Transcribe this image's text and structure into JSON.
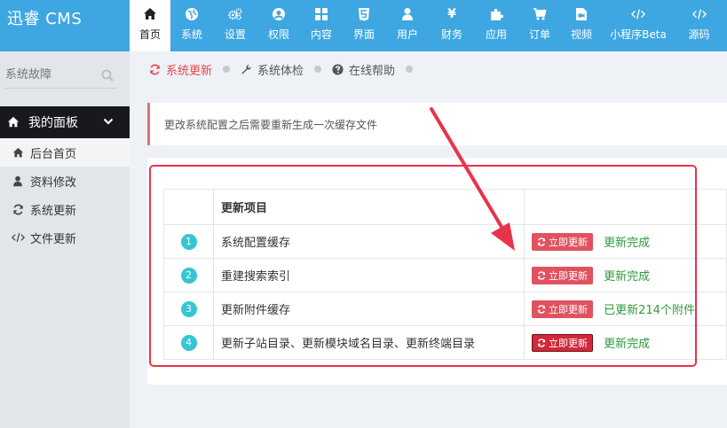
{
  "app": {
    "logo": "迅睿 CMS"
  },
  "nav": [
    {
      "label": "首页",
      "icon": "home-icon",
      "active": true
    },
    {
      "label": "系统",
      "icon": "globe-icon"
    },
    {
      "label": "设置",
      "icon": "gears-icon"
    },
    {
      "label": "权限",
      "icon": "user-circle-icon"
    },
    {
      "label": "内容",
      "icon": "grid-icon"
    },
    {
      "label": "界面",
      "icon": "html5-icon"
    },
    {
      "label": "用户",
      "icon": "user-icon"
    },
    {
      "label": "财务",
      "icon": "yen-icon"
    },
    {
      "label": "应用",
      "icon": "puzzle-icon"
    },
    {
      "label": "订单",
      "icon": "cart-icon"
    },
    {
      "label": "视频",
      "icon": "video-icon"
    },
    {
      "label": "小程序Beta",
      "icon": "code-icon"
    },
    {
      "label": "源码",
      "icon": "code-icon"
    }
  ],
  "sidebar": {
    "search_placeholder": "系统故障",
    "panel_title": "我的面板",
    "items": [
      {
        "label": "后台首页",
        "icon": "home-icon",
        "active": true
      },
      {
        "label": "资料修改",
        "icon": "user-icon"
      },
      {
        "label": "系统更新",
        "icon": "refresh-icon"
      },
      {
        "label": "文件更新",
        "icon": "code-icon"
      }
    ]
  },
  "subtabs": [
    {
      "label": "系统更新",
      "icon": "refresh-icon",
      "active": true
    },
    {
      "label": "系统体检",
      "icon": "wrench-icon"
    },
    {
      "label": "在线帮助",
      "icon": "question-icon"
    }
  ],
  "notice": "更改系统配置之后需要重新生成一次缓存文件",
  "table": {
    "header": "更新项目",
    "button_label": "立即更新",
    "rows": [
      {
        "num": "1",
        "name": "系统配置缓存",
        "status": "更新完成"
      },
      {
        "num": "2",
        "name": "重建搜索索引",
        "status": "更新完成"
      },
      {
        "num": "3",
        "name": "更新附件缓存",
        "status": "已更新214个附件"
      },
      {
        "num": "4",
        "name": "更新子站目录、更新模块域名目录、更新终端目录",
        "status": "更新完成"
      }
    ]
  },
  "colors": {
    "brand": "#3ea7e1",
    "annotation": "#e8334a",
    "success": "#2f9a3e",
    "badge": "#36c6d3"
  }
}
